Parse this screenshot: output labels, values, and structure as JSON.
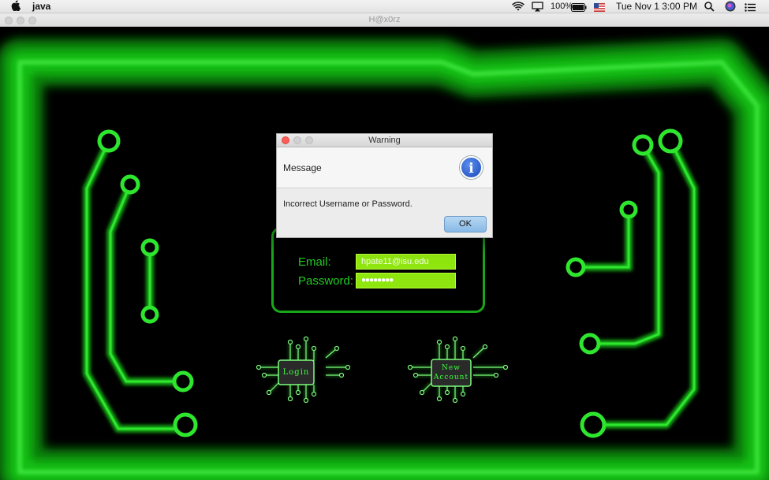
{
  "menubar": {
    "app_name": "java",
    "battery": "100%",
    "datetime": "Tue Nov 1  3:00 PM"
  },
  "window": {
    "title": "H@x0rz"
  },
  "login": {
    "email_label": "Email:",
    "email_value": "hpate11@isu.edu",
    "password_label": "Password:",
    "password_value": "●●●●●●●●",
    "login_button": "Login",
    "new_account_line1": "New",
    "new_account_line2": "Account"
  },
  "dialog": {
    "title": "Warning",
    "heading": "Message",
    "message": "Incorrect Username or Password.",
    "ok_label": "OK"
  },
  "colors": {
    "accent": "#22ff22",
    "field_bg": "#8fe60f",
    "background": "#000000"
  }
}
